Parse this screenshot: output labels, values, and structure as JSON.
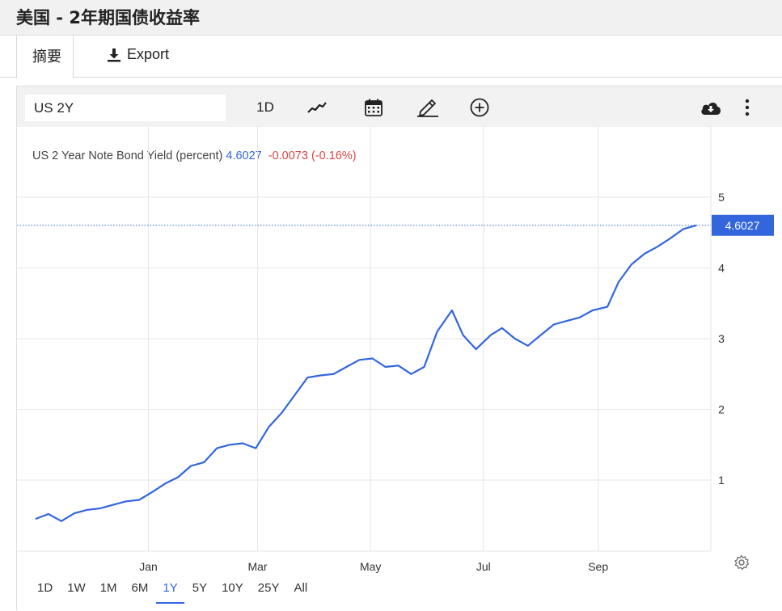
{
  "page": {
    "title": "美国 - 2年期国债收益率"
  },
  "tabs": {
    "summary": "摘要",
    "export": "Export"
  },
  "toolbar": {
    "symbol": "US 2Y",
    "interval": "1D",
    "icons": [
      "line-chart-icon",
      "calendar-icon",
      "pencil-icon",
      "add-circle-icon",
      "cloud-download-icon",
      "more-vertical-icon"
    ]
  },
  "legend": {
    "name": "US 2 Year Note Bond Yield (percent)",
    "last": "4.6027",
    "change": "-0.0073 (-0.16%)"
  },
  "ranges": {
    "items": [
      "1D",
      "1W",
      "1M",
      "6M",
      "1Y",
      "5Y",
      "10Y",
      "25Y",
      "All"
    ],
    "active": "1Y"
  },
  "colors": {
    "line": "#3366dd",
    "badge": "#3366dd",
    "negative": "#dd4444",
    "grid": "#e6e6e6"
  },
  "chart_data": {
    "type": "line",
    "series": [
      {
        "name": "US 2 Year Note Bond Yield (percent)",
        "x": [
          "2021-11-01",
          "2021-11-08",
          "2021-11-15",
          "2021-11-22",
          "2021-11-29",
          "2021-12-06",
          "2021-12-13",
          "2021-12-20",
          "2021-12-27",
          "2022-01-03",
          "2022-01-10",
          "2022-01-17",
          "2022-01-24",
          "2022-01-31",
          "2022-02-07",
          "2022-02-14",
          "2022-02-21",
          "2022-02-28",
          "2022-03-07",
          "2022-03-14",
          "2022-03-21",
          "2022-03-28",
          "2022-04-04",
          "2022-04-11",
          "2022-04-18",
          "2022-04-25",
          "2022-05-02",
          "2022-05-09",
          "2022-05-16",
          "2022-05-23",
          "2022-05-30",
          "2022-06-06",
          "2022-06-14",
          "2022-06-20",
          "2022-06-27",
          "2022-07-05",
          "2022-07-11",
          "2022-07-18",
          "2022-07-25",
          "2022-08-01",
          "2022-08-08",
          "2022-08-15",
          "2022-08-22",
          "2022-08-29",
          "2022-09-06",
          "2022-09-12",
          "2022-09-19",
          "2022-09-26",
          "2022-10-03",
          "2022-10-10",
          "2022-10-17",
          "2022-10-24"
        ],
        "values": [
          0.45,
          0.52,
          0.42,
          0.53,
          0.58,
          0.6,
          0.65,
          0.7,
          0.72,
          0.83,
          0.95,
          1.04,
          1.2,
          1.25,
          1.45,
          1.5,
          1.52,
          1.45,
          1.75,
          1.95,
          2.2,
          2.45,
          2.48,
          2.5,
          2.6,
          2.7,
          2.72,
          2.6,
          2.62,
          2.5,
          2.6,
          3.1,
          3.4,
          3.05,
          2.85,
          3.05,
          3.15,
          3.0,
          2.9,
          3.05,
          3.2,
          3.25,
          3.3,
          3.4,
          3.45,
          3.8,
          4.05,
          4.2,
          4.3,
          4.42,
          4.55,
          4.6027
        ]
      }
    ],
    "x_ticks": [
      "Jan",
      "Mar",
      "May",
      "Jul",
      "Sep"
    ],
    "x_tick_dates": [
      "2022-01-01",
      "2022-03-01",
      "2022-05-01",
      "2022-07-01",
      "2022-09-01"
    ],
    "x_range": [
      "2021-10-22",
      "2022-10-24"
    ],
    "y_ticks": [
      1,
      2,
      3,
      4,
      5
    ],
    "ylim": [
      0,
      5.5
    ],
    "y_axis_position": "right",
    "grid": true,
    "last_value_label": "4.6027"
  }
}
